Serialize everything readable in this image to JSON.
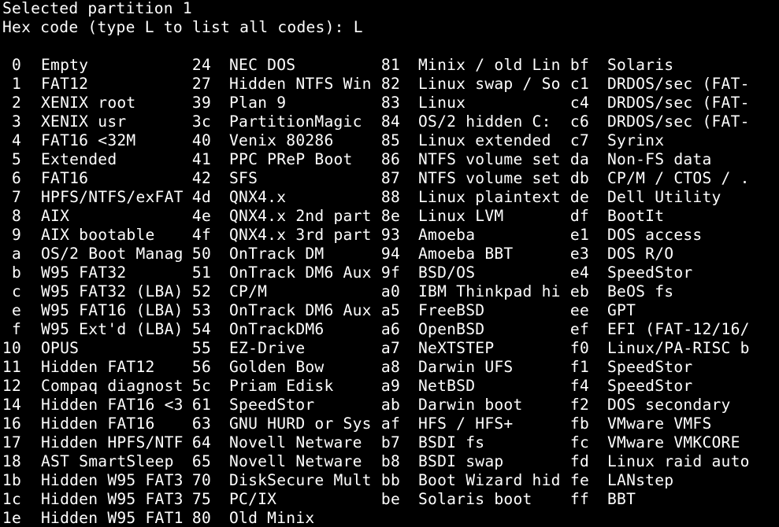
{
  "terminal": {
    "line1": "Selected partition 1",
    "line2": "Hex code (type L to list all codes): L"
  },
  "partition_types": {
    "rows": [
      [
        {
          "code": "0",
          "name": "Empty"
        },
        {
          "code": "24",
          "name": "NEC DOS"
        },
        {
          "code": "81",
          "name": "Minix / old Lin"
        },
        {
          "code": "bf",
          "name": "Solaris"
        }
      ],
      [
        {
          "code": "1",
          "name": "FAT12"
        },
        {
          "code": "27",
          "name": "Hidden NTFS Win"
        },
        {
          "code": "82",
          "name": "Linux swap / So"
        },
        {
          "code": "c1",
          "name": "DRDOS/sec (FAT-"
        }
      ],
      [
        {
          "code": "2",
          "name": "XENIX root"
        },
        {
          "code": "39",
          "name": "Plan 9"
        },
        {
          "code": "83",
          "name": "Linux"
        },
        {
          "code": "c4",
          "name": "DRDOS/sec (FAT-"
        }
      ],
      [
        {
          "code": "3",
          "name": "XENIX usr"
        },
        {
          "code": "3c",
          "name": "PartitionMagic"
        },
        {
          "code": "84",
          "name": "OS/2 hidden C:"
        },
        {
          "code": "c6",
          "name": "DRDOS/sec (FAT-"
        }
      ],
      [
        {
          "code": "4",
          "name": "FAT16 <32M"
        },
        {
          "code": "40",
          "name": "Venix 80286"
        },
        {
          "code": "85",
          "name": "Linux extended"
        },
        {
          "code": "c7",
          "name": "Syrinx"
        }
      ],
      [
        {
          "code": "5",
          "name": "Extended"
        },
        {
          "code": "41",
          "name": "PPC PReP Boot"
        },
        {
          "code": "86",
          "name": "NTFS volume set"
        },
        {
          "code": "da",
          "name": "Non-FS data"
        }
      ],
      [
        {
          "code": "6",
          "name": "FAT16"
        },
        {
          "code": "42",
          "name": "SFS"
        },
        {
          "code": "87",
          "name": "NTFS volume set"
        },
        {
          "code": "db",
          "name": "CP/M / CTOS / ."
        }
      ],
      [
        {
          "code": "7",
          "name": "HPFS/NTFS/exFAT"
        },
        {
          "code": "4d",
          "name": "QNX4.x"
        },
        {
          "code": "88",
          "name": "Linux plaintext"
        },
        {
          "code": "de",
          "name": "Dell Utility"
        }
      ],
      [
        {
          "code": "8",
          "name": "AIX"
        },
        {
          "code": "4e",
          "name": "QNX4.x 2nd part"
        },
        {
          "code": "8e",
          "name": "Linux LVM"
        },
        {
          "code": "df",
          "name": "BootIt"
        }
      ],
      [
        {
          "code": "9",
          "name": "AIX bootable"
        },
        {
          "code": "4f",
          "name": "QNX4.x 3rd part"
        },
        {
          "code": "93",
          "name": "Amoeba"
        },
        {
          "code": "e1",
          "name": "DOS access"
        }
      ],
      [
        {
          "code": "a",
          "name": "OS/2 Boot Manag"
        },
        {
          "code": "50",
          "name": "OnTrack DM"
        },
        {
          "code": "94",
          "name": "Amoeba BBT"
        },
        {
          "code": "e3",
          "name": "DOS R/O"
        }
      ],
      [
        {
          "code": "b",
          "name": "W95 FAT32"
        },
        {
          "code": "51",
          "name": "OnTrack DM6 Aux"
        },
        {
          "code": "9f",
          "name": "BSD/OS"
        },
        {
          "code": "e4",
          "name": "SpeedStor"
        }
      ],
      [
        {
          "code": "c",
          "name": "W95 FAT32 (LBA)"
        },
        {
          "code": "52",
          "name": "CP/M"
        },
        {
          "code": "a0",
          "name": "IBM Thinkpad hi"
        },
        {
          "code": "eb",
          "name": "BeOS fs"
        }
      ],
      [
        {
          "code": "e",
          "name": "W95 FAT16 (LBA)"
        },
        {
          "code": "53",
          "name": "OnTrack DM6 Aux"
        },
        {
          "code": "a5",
          "name": "FreeBSD"
        },
        {
          "code": "ee",
          "name": "GPT"
        }
      ],
      [
        {
          "code": "f",
          "name": "W95 Ext'd (LBA)"
        },
        {
          "code": "54",
          "name": "OnTrackDM6"
        },
        {
          "code": "a6",
          "name": "OpenBSD"
        },
        {
          "code": "ef",
          "name": "EFI (FAT-12/16/"
        }
      ],
      [
        {
          "code": "10",
          "name": "OPUS"
        },
        {
          "code": "55",
          "name": "EZ-Drive"
        },
        {
          "code": "a7",
          "name": "NeXTSTEP"
        },
        {
          "code": "f0",
          "name": "Linux/PA-RISC b"
        }
      ],
      [
        {
          "code": "11",
          "name": "Hidden FAT12"
        },
        {
          "code": "56",
          "name": "Golden Bow"
        },
        {
          "code": "a8",
          "name": "Darwin UFS"
        },
        {
          "code": "f1",
          "name": "SpeedStor"
        }
      ],
      [
        {
          "code": "12",
          "name": "Compaq diagnost"
        },
        {
          "code": "5c",
          "name": "Priam Edisk"
        },
        {
          "code": "a9",
          "name": "NetBSD"
        },
        {
          "code": "f4",
          "name": "SpeedStor"
        }
      ],
      [
        {
          "code": "14",
          "name": "Hidden FAT16 <3"
        },
        {
          "code": "61",
          "name": "SpeedStor"
        },
        {
          "code": "ab",
          "name": "Darwin boot"
        },
        {
          "code": "f2",
          "name": "DOS secondary"
        }
      ],
      [
        {
          "code": "16",
          "name": "Hidden FAT16"
        },
        {
          "code": "63",
          "name": "GNU HURD or Sys"
        },
        {
          "code": "af",
          "name": "HFS / HFS+"
        },
        {
          "code": "fb",
          "name": "VMware VMFS"
        }
      ],
      [
        {
          "code": "17",
          "name": "Hidden HPFS/NTF"
        },
        {
          "code": "64",
          "name": "Novell Netware"
        },
        {
          "code": "b7",
          "name": "BSDI fs"
        },
        {
          "code": "fc",
          "name": "VMware VMKCORE"
        }
      ],
      [
        {
          "code": "18",
          "name": "AST SmartSleep"
        },
        {
          "code": "65",
          "name": "Novell Netware"
        },
        {
          "code": "b8",
          "name": "BSDI swap"
        },
        {
          "code": "fd",
          "name": "Linux raid auto"
        }
      ],
      [
        {
          "code": "1b",
          "name": "Hidden W95 FAT3"
        },
        {
          "code": "70",
          "name": "DiskSecure Mult"
        },
        {
          "code": "bb",
          "name": "Boot Wizard hid"
        },
        {
          "code": "fe",
          "name": "LANstep"
        }
      ],
      [
        {
          "code": "1c",
          "name": "Hidden W95 FAT3"
        },
        {
          "code": "75",
          "name": "PC/IX"
        },
        {
          "code": "be",
          "name": "Solaris boot"
        },
        {
          "code": "ff",
          "name": "BBT"
        }
      ],
      [
        {
          "code": "1e",
          "name": "Hidden W95 FAT1"
        },
        {
          "code": "80",
          "name": "Old Minix"
        }
      ]
    ]
  },
  "colors": {
    "background": "#000000",
    "foreground": "#ffffff"
  }
}
